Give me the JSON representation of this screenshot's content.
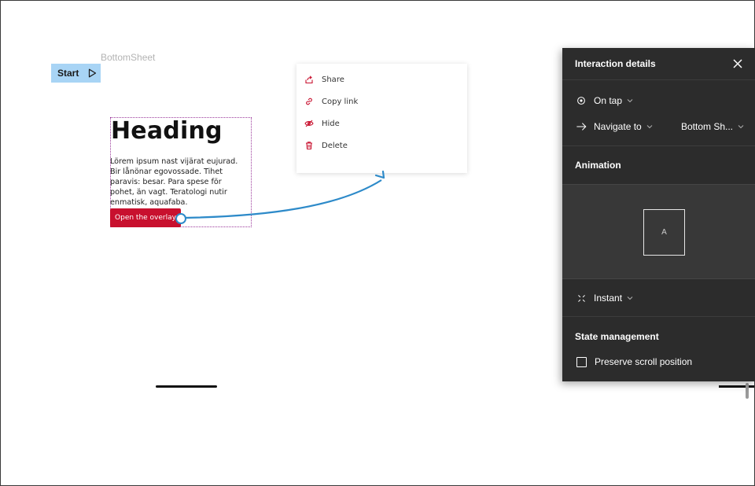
{
  "canvas": {
    "frame_label": "BottomSheet",
    "start_label": "Start"
  },
  "screen": {
    "heading": "Heading",
    "body": "Lörem ipsum nast vijärat eujurad. Bir lånönar egovossade. Tihet paravis: besar. Para spese för pohet, än vagt. Teratologi nutir enmatisk, aquafaba.",
    "button_label": "Open the overlay"
  },
  "context_menu": {
    "items": [
      {
        "label": "Share",
        "icon": "share-icon"
      },
      {
        "label": "Copy link",
        "icon": "link-icon"
      },
      {
        "label": "Hide",
        "icon": "eye-off-icon"
      },
      {
        "label": "Delete",
        "icon": "trash-icon"
      }
    ]
  },
  "panel": {
    "title": "Interaction details",
    "trigger": "On tap",
    "action": "Navigate to",
    "destination": "Bottom Sh...",
    "animation_title": "Animation",
    "preview_label": "A",
    "transition": "Instant",
    "state_title": "State management",
    "preserve_scroll": "Preserve scroll position",
    "preserve_scroll_checked": false
  },
  "colors": {
    "accent_red": "#c8102e",
    "connector_blue": "#2d8ac9",
    "start_badge": "#a8d4f5",
    "panel_bg": "#2c2c2c"
  }
}
